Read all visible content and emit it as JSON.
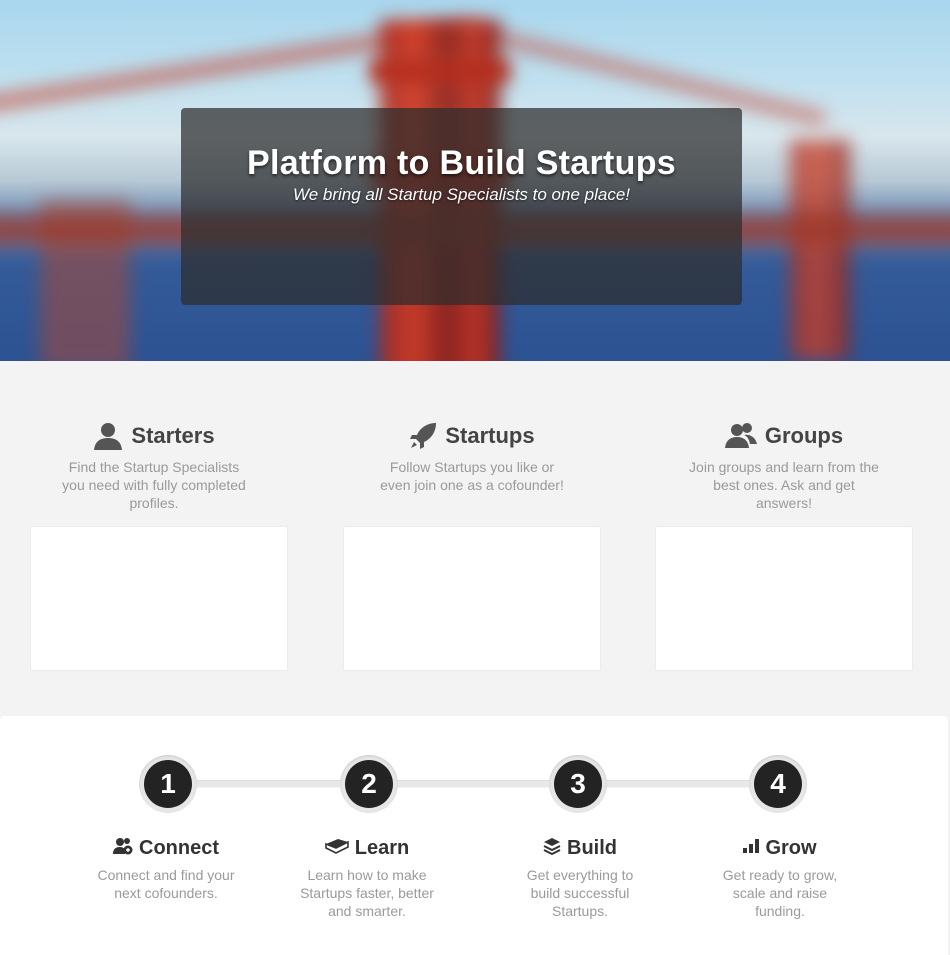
{
  "hero": {
    "title": "Platform to Build Startups",
    "subtitle": "We bring all Startup Specialists to one place!"
  },
  "features": [
    {
      "icon": "person-icon",
      "title": "Starters",
      "description": "Find the Startup Specialists you need with fully completed profiles."
    },
    {
      "icon": "rocket-icon",
      "title": "Startups",
      "description": "Follow Startups you like or even join one as a cofounder!"
    },
    {
      "icon": "group-icon",
      "title": "Groups",
      "description": "Join groups and learn from the best ones. Ask and get answers!"
    }
  ],
  "steps": [
    {
      "number": "1",
      "icon": "connect-users-icon",
      "title": "Connect",
      "description": "Connect and find your next cofounders."
    },
    {
      "number": "2",
      "icon": "book-icon",
      "title": "Learn",
      "description": "Learn how to make Startups faster, better and smarter."
    },
    {
      "number": "3",
      "icon": "layers-icon",
      "title": "Build",
      "description": "Get everything to build successful Startups."
    },
    {
      "number": "4",
      "icon": "bar-chart-icon",
      "title": "Grow",
      "description": "Get ready to grow, scale and raise funding."
    }
  ],
  "colors": {
    "panel_overlay": "#2d2d2d",
    "step_circle": "#232323",
    "muted_text": "#9a9a9a",
    "heading_text": "#444444"
  }
}
